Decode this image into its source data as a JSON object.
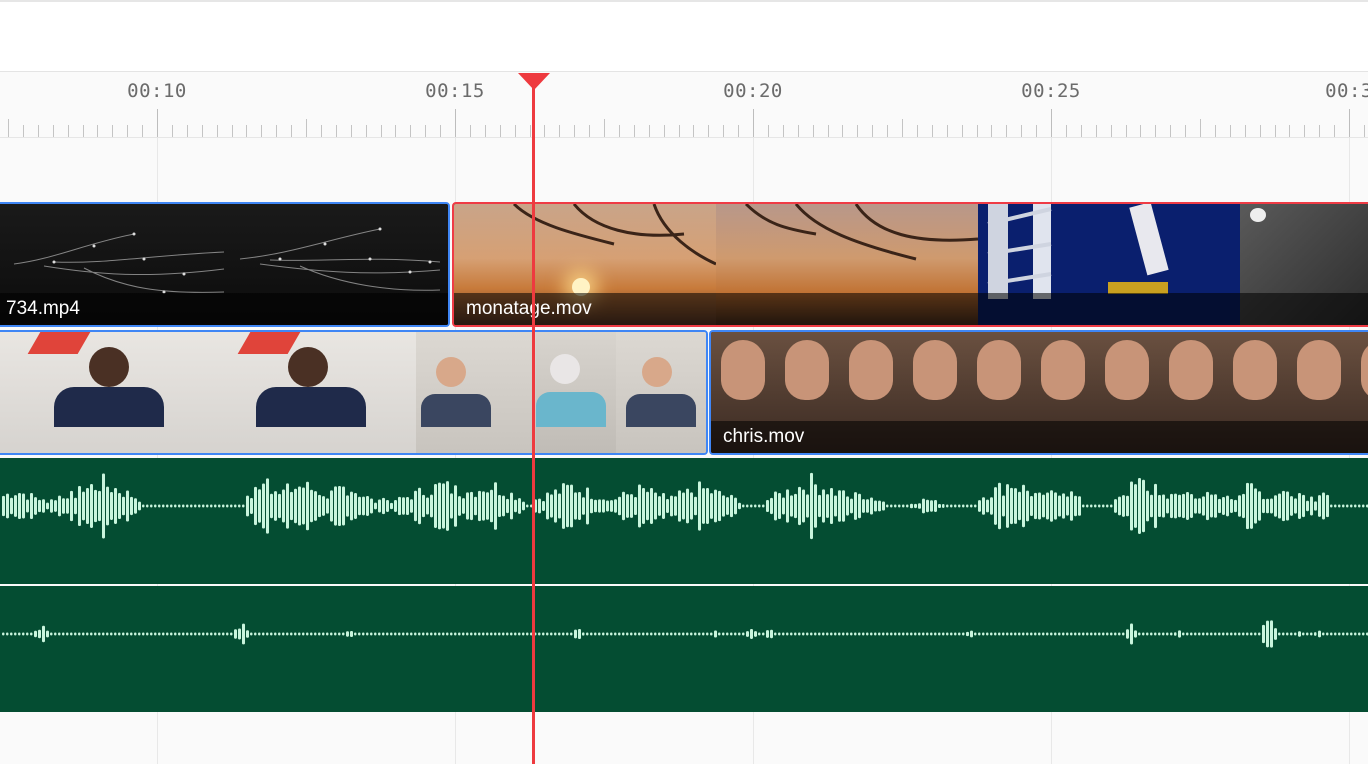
{
  "ruler": {
    "labels": [
      "00:10",
      "00:15",
      "00:20",
      "00:25",
      "00:3"
    ]
  },
  "tracks": {
    "video_top": [
      {
        "label": "734.mp4",
        "content": "dark slide with branching diagram",
        "selected": false
      },
      {
        "label": "monatage.mov",
        "content": "sunset cherry blossoms, rocket launch tower",
        "selected": true
      }
    ],
    "video_bottom": [
      {
        "label": "",
        "content": "podcast hosts with headphones and microphones",
        "selected": false
      },
      {
        "label": "chris.mov",
        "content": "close-up of man speaking",
        "selected": false
      }
    ],
    "audio": [
      {
        "name": "audio-track-1"
      },
      {
        "name": "audio-track-2"
      }
    ]
  },
  "colors": {
    "playhead": "#ee3a3f",
    "selection_blue": "#3f86f5",
    "selection_red": "#ef3b45",
    "audio_bg": "#044d32",
    "waveform": "#c9f5dd"
  },
  "playhead": {
    "time": "00:16.3"
  }
}
